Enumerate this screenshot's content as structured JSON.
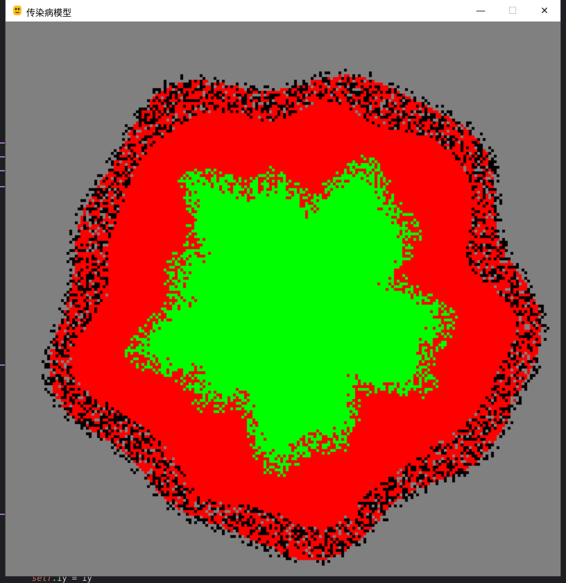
{
  "window": {
    "title": "传染病模型",
    "icon": "pygame-snake-icon",
    "buttons": {
      "minimize": "—",
      "maximize": "☐",
      "close": "✕"
    }
  },
  "simulation": {
    "background_color": "#808080",
    "healthy_color": "#00ff00",
    "infected_color": "#ff0000",
    "dead_color": "#000000"
  },
  "background_editor": {
    "code_line_fragment_kw": "self",
    "code_line_fragment_rest": ".iy = iy"
  }
}
